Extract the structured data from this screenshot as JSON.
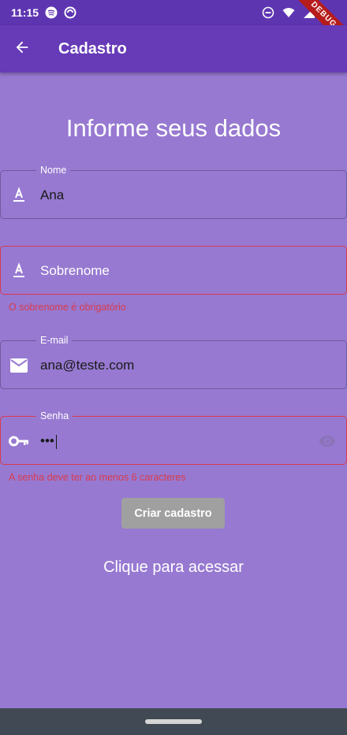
{
  "status_bar": {
    "time": "11:15",
    "icons": [
      "spotify-icon",
      "sync-circle-icon",
      "do-not-disturb-icon",
      "wifi-icon",
      "signal-icon"
    ],
    "debug_banner": "DEBUG"
  },
  "app_bar": {
    "title": "Cadastro",
    "back_icon": "arrow-left-icon",
    "color": "#673ab7"
  },
  "heading": "Informe seus dados",
  "form": {
    "nome": {
      "label": "Nome",
      "value": "Ana",
      "icon": "text-format-icon"
    },
    "sobrenome": {
      "placeholder": "Sobrenome",
      "value": "",
      "icon": "text-format-icon",
      "error": "O sobrenome é obrigatório"
    },
    "email": {
      "label": "E-mail",
      "value": "ana@teste.com",
      "icon": "mail-icon"
    },
    "senha": {
      "label": "Senha",
      "value": "•••",
      "icon": "key-icon",
      "toggle_icon": "eye-icon",
      "error": "A senha deve ter ao menos 6 caracteres"
    }
  },
  "submit_label": "Criar cadastro",
  "login_link": "Clique para acessar",
  "colors": {
    "background": "#9779d1",
    "error": "#d83b4e",
    "button_disabled": "#a0a0a0"
  }
}
